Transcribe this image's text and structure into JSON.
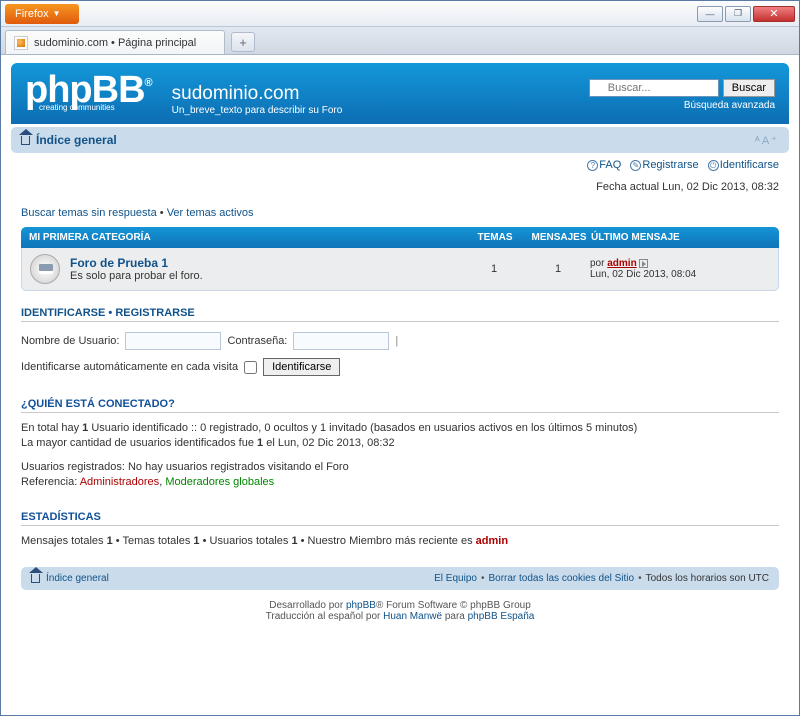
{
  "browser": {
    "name": "Firefox",
    "tab_title": "sudominio.com • Página principal"
  },
  "header": {
    "logo_text": "phpBB",
    "logo_tag": "creating    communities",
    "site_name": "sudominio.com",
    "site_desc": "Un_breve_texto para describir su Foro"
  },
  "search": {
    "placeholder": "Buscar...",
    "button": "Buscar",
    "advanced": "Búsqueda avanzada"
  },
  "nav": {
    "index": "Índice general"
  },
  "links": {
    "faq": "FAQ",
    "register": "Registrarse",
    "login": "Identificarse"
  },
  "datetime": "Fecha actual Lun, 02 Dic 2013, 08:32",
  "toplinks": {
    "unanswered": "Buscar temas sin respuesta",
    "active": "Ver temas activos",
    "sep": " • "
  },
  "forumtable": {
    "category": "MI PRIMERA CATEGORÍA",
    "th_topics": "TEMAS",
    "th_posts": "MENSAJES",
    "th_last": "ÚLTIMO MENSAJE",
    "row": {
      "title": "Foro de Prueba 1",
      "desc": "Es solo para probar el foro.",
      "topics": "1",
      "posts": "1",
      "by": "por ",
      "author": "admin",
      "date": "Lun, 02 Dic 2013, 08:04"
    }
  },
  "login_sect": {
    "heading_login": "IDENTIFICARSE",
    "heading_sep": "  •  ",
    "heading_reg": "REGISTRARSE",
    "user_label": "Nombre de Usuario:",
    "pass_label": "Contraseña:",
    "auto_label": "Identificarse automáticamente en cada visita",
    "button": "Identificarse"
  },
  "online": {
    "heading": "¿QUIÉN ESTÁ CONECTADO?",
    "l1a": "En total hay ",
    "l1b": "1",
    "l1c": " Usuario identificado :: 0 registrado, 0 ocultos y 1 invitado (basados en usuarios activos en los últimos 5 minutos)",
    "l2a": "La mayor cantidad de usuarios identificados fue ",
    "l2b": "1",
    "l2c": " el Lun, 02 Dic 2013, 08:32",
    "l3": "Usuarios registrados: No hay usuarios registrados visitando el Foro",
    "l4a": "Referencia: ",
    "l4b": "Administradores",
    "l4c": ", ",
    "l4d": "Moderadores globales"
  },
  "stats": {
    "heading": "ESTADÍSTICAS",
    "a": "Mensajes totales ",
    "av": "1",
    "b": " • Temas totales ",
    "bv": "1",
    "c": " • Usuarios totales ",
    "cv": "1",
    "d": " • Nuestro Miembro más reciente es ",
    "dv": "admin"
  },
  "footer": {
    "index": "Índice general",
    "team": "El Equipo",
    "cookies": "Borrar todas las cookies del Sitio",
    "tz": "Todos los horarios son UTC"
  },
  "credits": {
    "l1a": "Desarrollado por ",
    "l1b": "phpBB",
    "l1c": "® Forum Software © phpBB Group",
    "l2a": "Traducción al español por ",
    "l2b": "Huan Manwë",
    "l2c": " para ",
    "l2d": "phpBB España"
  }
}
